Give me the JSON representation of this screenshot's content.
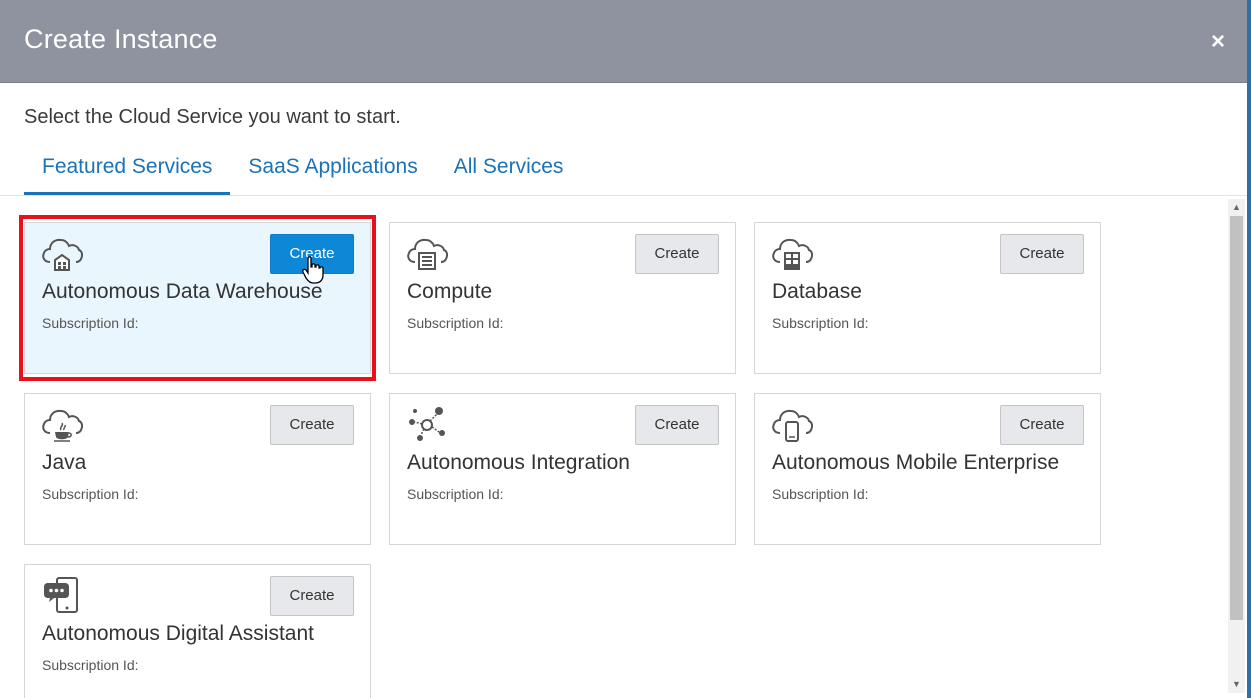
{
  "dialog": {
    "title": "Create Instance",
    "close_symbol": "×"
  },
  "instruction": "Select the Cloud Service you want to start.",
  "tabs": [
    {
      "label": "Featured Services",
      "active": true
    },
    {
      "label": "SaaS Applications",
      "active": false
    },
    {
      "label": "All Services",
      "active": false
    }
  ],
  "services": [
    {
      "name": "Autonomous Data Warehouse",
      "subscription_label": "Subscription Id:",
      "create_label": "Create",
      "icon": "cloud-warehouse-icon",
      "selected": true
    },
    {
      "name": "Compute",
      "subscription_label": "Subscription Id:",
      "create_label": "Create",
      "icon": "cloud-compute-icon",
      "selected": false
    },
    {
      "name": "Database",
      "subscription_label": "Subscription Id:",
      "create_label": "Create",
      "icon": "cloud-database-icon",
      "selected": false
    },
    {
      "name": "Java",
      "subscription_label": "Subscription Id:",
      "create_label": "Create",
      "icon": "cloud-java-icon",
      "selected": false
    },
    {
      "name": "Autonomous Integration",
      "subscription_label": "Subscription Id:",
      "create_label": "Create",
      "icon": "integration-network-icon",
      "selected": false
    },
    {
      "name": "Autonomous Mobile Enterprise",
      "subscription_label": "Subscription Id:",
      "create_label": "Create",
      "icon": "cloud-mobile-icon",
      "selected": false
    },
    {
      "name": "Autonomous Digital Assistant",
      "subscription_label": "Subscription Id:",
      "create_label": "Create",
      "icon": "chat-assistant-icon",
      "selected": false
    }
  ],
  "colors": {
    "header_bg": "#8f929f",
    "accent_blue": "#1a72b8",
    "primary_button": "#0e87d6",
    "selected_card_bg": "#eaf6fd",
    "highlight_red": "#e8101b"
  }
}
